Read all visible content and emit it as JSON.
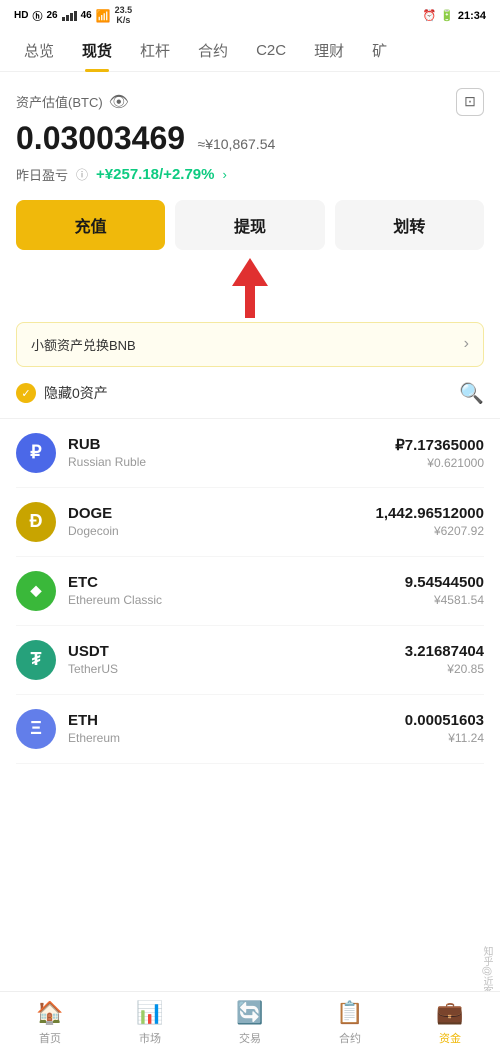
{
  "statusBar": {
    "left": "HD ⓗ 26 46 46",
    "speed": "23.5\nK/s",
    "time": "21:34",
    "battery": "20"
  },
  "navTabs": {
    "items": [
      "总览",
      "现货",
      "杠杆",
      "合约",
      "C2C",
      "理财",
      "矿"
    ]
  },
  "activeTab": "现货",
  "asset": {
    "label": "资产估值(BTC)",
    "btcValue": "0.03003469",
    "cnyValue": "≈¥10,867.54",
    "pnlLabel": "昨日盈亏",
    "pnlValue": "+¥257.18/+2.79%"
  },
  "buttons": {
    "deposit": "充值",
    "withdraw": "提现",
    "transfer": "划转"
  },
  "bnbBanner": {
    "text": "小额资产兑换BNB"
  },
  "filter": {
    "text": "隐藏0资产"
  },
  "coins": [
    {
      "symbol": "RUB",
      "name": "Russian Ruble",
      "amount": "₽7.17365000",
      "cny": "¥0.621000",
      "iconClass": "coin-rub",
      "iconText": "₽"
    },
    {
      "symbol": "DOGE",
      "name": "Dogecoin",
      "amount": "1,442.96512000",
      "cny": "¥6207.92",
      "iconClass": "coin-doge",
      "iconText": "Ð"
    },
    {
      "symbol": "ETC",
      "name": "Ethereum Classic",
      "amount": "9.54544500",
      "cny": "¥4581.54",
      "iconClass": "coin-etc",
      "iconText": "◆"
    },
    {
      "symbol": "USDT",
      "name": "TetherUS",
      "amount": "3.21687404",
      "cny": "¥20.85",
      "iconClass": "coin-usdt",
      "iconText": "₮"
    },
    {
      "symbol": "ETH",
      "name": "Ethereum",
      "amount": "0.00051603",
      "cny": "¥11.24",
      "iconClass": "coin-eth",
      "iconText": "Ξ"
    }
  ],
  "bottomNav": {
    "items": [
      "首页",
      "市场",
      "交易",
      "合约",
      "资金"
    ]
  },
  "activeNavItem": "资金"
}
